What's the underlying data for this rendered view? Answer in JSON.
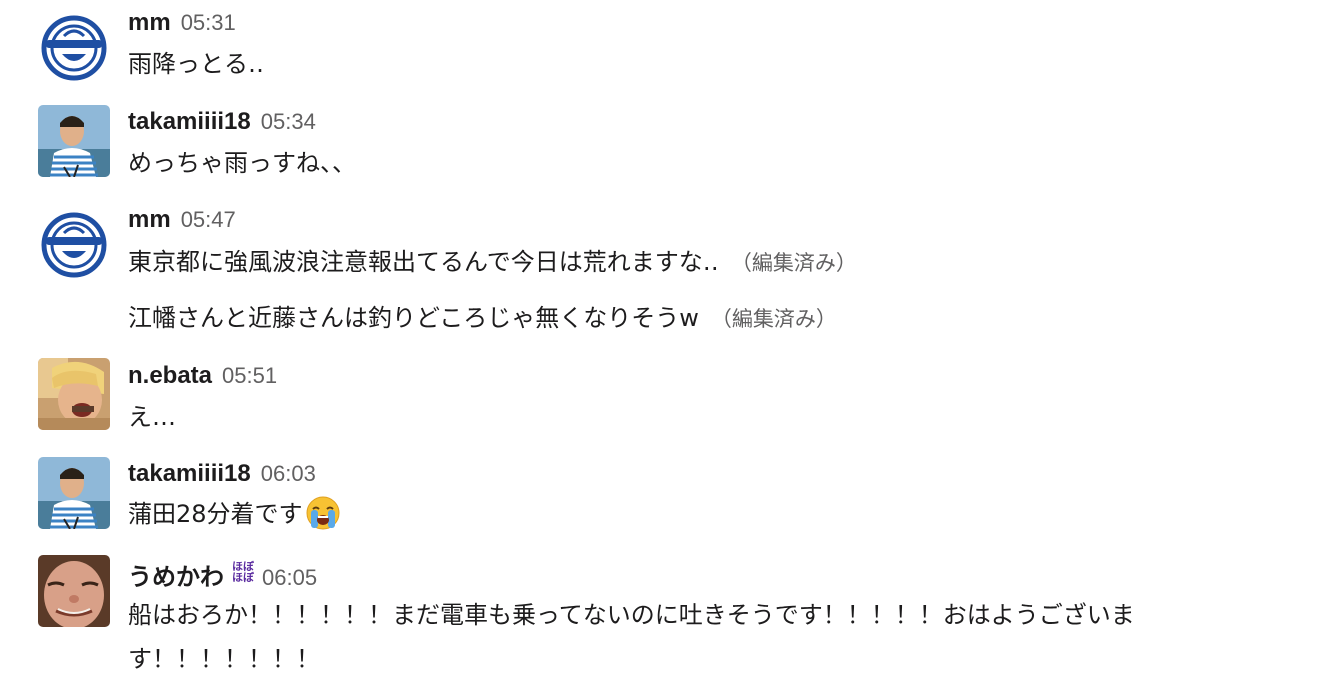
{
  "messages": [
    {
      "user": "mm",
      "time": "05:31",
      "avatar": "laughing-man-logo",
      "lines": [
        {
          "text": "雨降っとる‥"
        }
      ]
    },
    {
      "user": "takamiiii18",
      "time": "05:34",
      "avatar": "photo-man-striped-shirt",
      "lines": [
        {
          "text": "めっちゃ雨っすね、、"
        }
      ]
    },
    {
      "user": "mm",
      "time": "05:47",
      "avatar": "laughing-man-logo",
      "lines": [
        {
          "text": "東京都に強風波浪注意報出てるんで今日は荒れますな‥",
          "edited": "（編集済み）"
        },
        {
          "text": "江幡さんと近藤さんは釣りどころじゃ無くなりそうw",
          "edited": "（編集済み）"
        }
      ]
    },
    {
      "user": "n.ebata",
      "time": "05:51",
      "avatar": "photo-man-eating",
      "lines": [
        {
          "text": "え…"
        }
      ]
    },
    {
      "user": "takamiiii18",
      "time": "06:03",
      "avatar": "photo-man-striped-shirt",
      "lines": [
        {
          "text": "蒲田28分着です",
          "emoji": "loudly-crying-face-emoji"
        }
      ]
    },
    {
      "user": "うめかわ",
      "time": "06:05",
      "avatar": "photo-man-smiling",
      "badge": [
        "ほぼ",
        "ほぼ"
      ],
      "lines": [
        {
          "text": "船はおろか！！！！！！まだ電車も乗ってないのに吐きそうです！！！！！おはようございます！！！！！！！"
        }
      ]
    }
  ],
  "colors": {
    "username": "#1d1c1d",
    "timestamp": "#616061",
    "edited": "#616061",
    "badge": "#5b2ca0",
    "background": "#ffffff"
  }
}
